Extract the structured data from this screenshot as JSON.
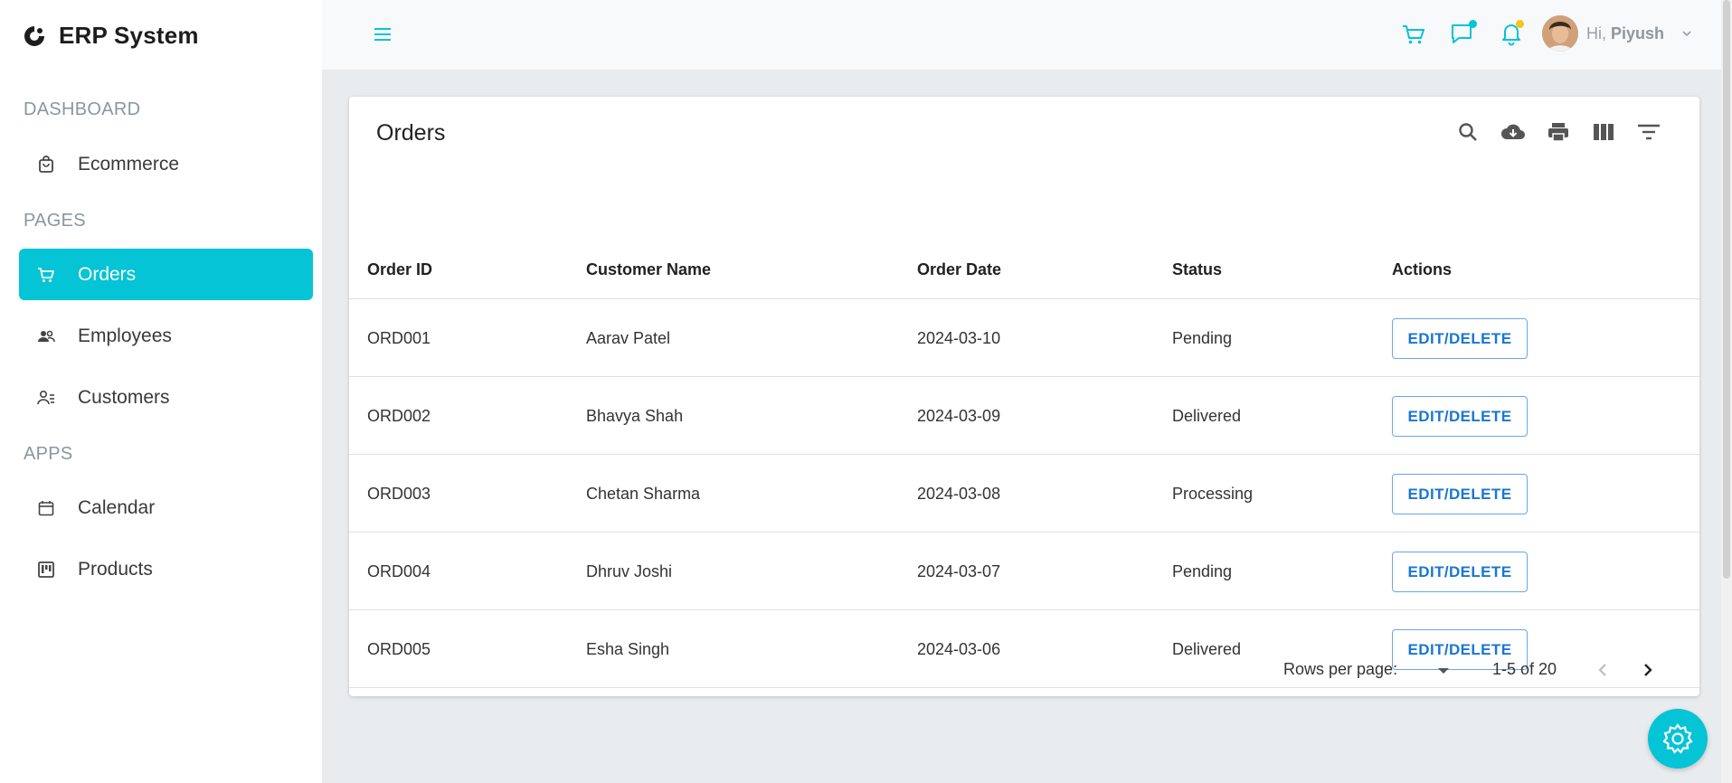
{
  "brand": {
    "title": "ERP System"
  },
  "sidebar": {
    "sections": [
      {
        "label": "DASHBOARD",
        "items": [
          {
            "label": "Ecommerce",
            "icon": "bag-icon"
          }
        ]
      },
      {
        "label": "PAGES",
        "items": [
          {
            "label": "Orders",
            "icon": "cart-icon",
            "active": true
          },
          {
            "label": "Employees",
            "icon": "people-icon"
          },
          {
            "label": "Customers",
            "icon": "customer-icon"
          }
        ]
      },
      {
        "label": "APPS",
        "items": [
          {
            "label": "Calendar",
            "icon": "calendar-icon"
          },
          {
            "label": "Products",
            "icon": "kanban-icon"
          }
        ]
      }
    ]
  },
  "topbar": {
    "greeting": "Hi,",
    "user_name": "Piyush",
    "icons": [
      "menu-icon",
      "cart-icon",
      "chat-icon",
      "bell-icon",
      "chevron-down-icon"
    ],
    "badge_colors": {
      "chat": "#04c4d6",
      "bell": "#f5c518"
    }
  },
  "orders": {
    "title": "Orders",
    "toolbar_icons": [
      "search-icon",
      "cloud-download-icon",
      "print-icon",
      "columns-icon",
      "filter-icon"
    ],
    "columns": [
      "Order ID",
      "Customer Name",
      "Order Date",
      "Status",
      "Actions"
    ],
    "rows": [
      {
        "id": "ORD001",
        "name": "Aarav Patel",
        "date": "2024-03-10",
        "status": "Pending",
        "action": "EDIT/DELETE"
      },
      {
        "id": "ORD002",
        "name": "Bhavya Shah",
        "date": "2024-03-09",
        "status": "Delivered",
        "action": "EDIT/DELETE"
      },
      {
        "id": "ORD003",
        "name": "Chetan Sharma",
        "date": "2024-03-08",
        "status": "Processing",
        "action": "EDIT/DELETE"
      },
      {
        "id": "ORD004",
        "name": "Dhruv Joshi",
        "date": "2024-03-07",
        "status": "Pending",
        "action": "EDIT/DELETE"
      },
      {
        "id": "ORD005",
        "name": "Esha Singh",
        "date": "2024-03-06",
        "status": "Delivered",
        "action": "EDIT/DELETE"
      }
    ],
    "pagination": {
      "rows_per_page_label": "Rows per page:",
      "range": "1-5 of 20"
    }
  },
  "colors": {
    "accent": "#04c4d6",
    "link": "#1976d2"
  }
}
